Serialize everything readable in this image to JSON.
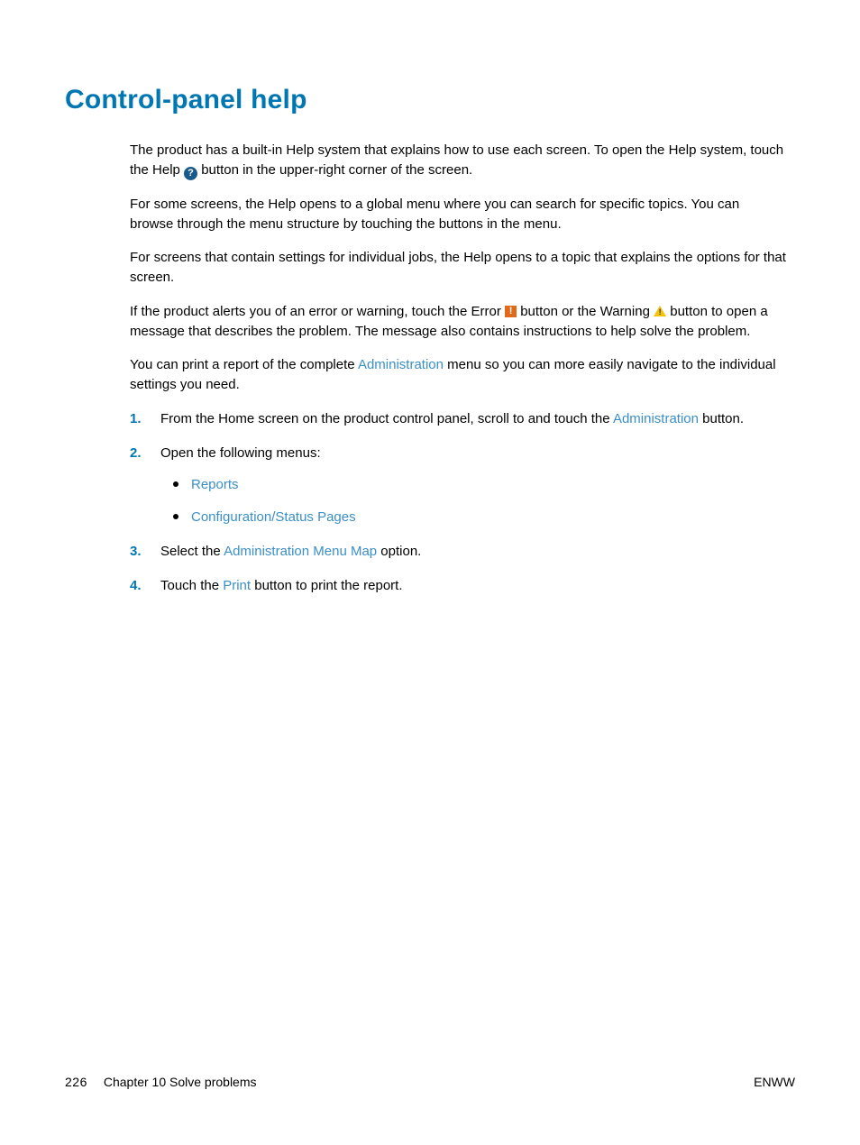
{
  "title": "Control-panel help",
  "p1a": "The product has a built-in Help system that explains how to use each screen. To open the Help system, touch the Help ",
  "p1b": " button in the upper-right corner of the screen.",
  "p2": "For some screens, the Help opens to a global menu where you can search for specific topics. You can browse through the menu structure by touching the buttons in the menu.",
  "p3": "For screens that contain settings for individual jobs, the Help opens to a topic that explains the options for that screen.",
  "p4a": "If the product alerts you of an error or warning, touch the Error ",
  "p4b": " button or the Warning ",
  "p4c": " button to open a message that describes the problem. The message also contains instructions to help solve the problem.",
  "p5a": "You can print a report of the complete ",
  "p5_ui": "Administration",
  "p5b": " menu so you can more easily navigate to the individual settings you need.",
  "step1a": "From the Home screen on the product control panel, scroll to and touch the ",
  "step1_ui": "Administration",
  "step1b": " button.",
  "step2": "Open the following menus:",
  "sub1": "Reports",
  "sub2": "Configuration/Status Pages",
  "step3a": "Select the ",
  "step3_ui": "Administration Menu Map",
  "step3b": " option.",
  "step4a": "Touch the ",
  "step4_ui": "Print",
  "step4b": " button to print the report.",
  "footer": {
    "page": "226",
    "chapter": "Chapter 10   Solve problems",
    "loc": "ENWW"
  }
}
